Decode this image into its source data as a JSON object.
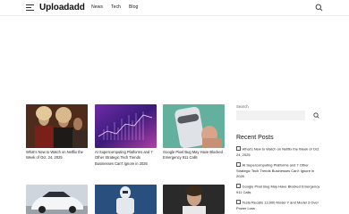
{
  "header": {
    "logo": "Uploadadd",
    "nav": [
      "News",
      "Tech",
      "Blog"
    ]
  },
  "cards": [
    {
      "title": "What's New to Watch on Netflix the Week of Oct. 24, 2025",
      "image": "women-in-costume-photo"
    },
    {
      "title": "AI Supercomputing Platforms and 7 Other Strategic Tech Trends Businesses Can't Ignore in 2026",
      "image": "purple-data-graph-photo"
    },
    {
      "title": "Google Pixel Bug May Have Blocked Emergency 911 Calls",
      "image": "pixel-phone-photo"
    },
    {
      "title": "",
      "image": "white-car-photo"
    },
    {
      "title": "",
      "image": "robot-photo"
    },
    {
      "title": "",
      "image": "person-photo"
    }
  ],
  "sidebar": {
    "search_label": "Search",
    "recent_heading": "Recent Posts",
    "posts": [
      "What's New to Watch on Netflix the Week of Oct. 24, 2025",
      "AI Supercomputing Platforms and 7 Other Strategic Tech Trends Businesses Can't Ignore in 2026",
      "Google Pixel Bug May Have Blocked Emergency 911 Calls",
      "Tesla Recalls 13,000 Model Y and Model 3 Over Power Loss"
    ]
  }
}
